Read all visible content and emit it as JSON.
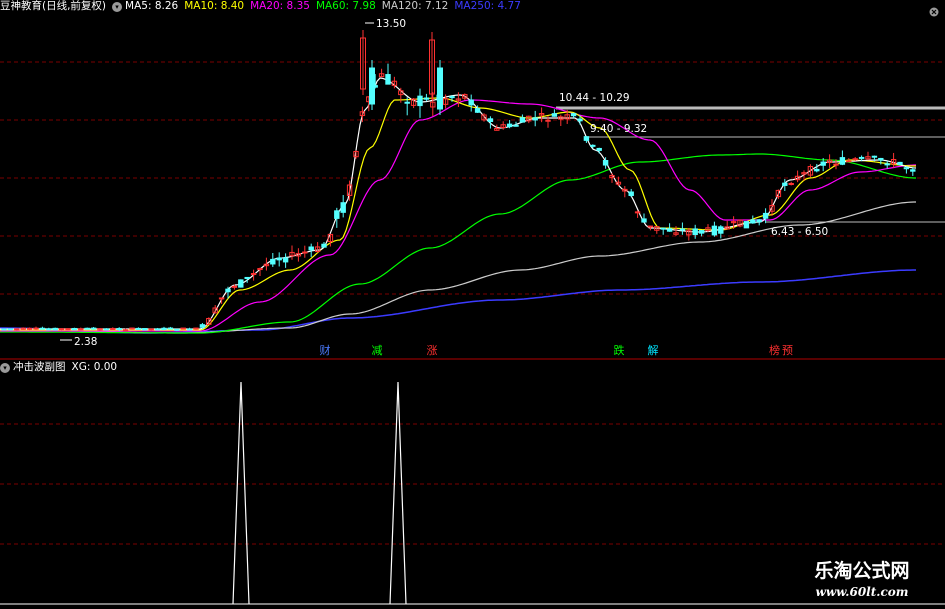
{
  "main_header": {
    "title": "豆神教育(日线,前复权)",
    "indicators": [
      {
        "label": "MA5: 8.26",
        "color": "#ffffff"
      },
      {
        "label": "MA10: 8.40",
        "color": "#ffff00"
      },
      {
        "label": "MA20: 8.35",
        "color": "#ff00ff"
      },
      {
        "label": "MA60: 7.98",
        "color": "#00ff00"
      },
      {
        "label": "MA120: 7.12",
        "color": "#cccccc"
      },
      {
        "label": "MA250: 4.77",
        "color": "#3b3bff"
      }
    ]
  },
  "sub_header": {
    "title": "冲击波副图",
    "value": "XG: 0.00"
  },
  "price_labels": {
    "high": "13.50",
    "low": "2.38",
    "range_top": "10.44 - 10.29",
    "range_mid": "9.40 - 9.32",
    "range_low": "6.43 - 6.50"
  },
  "events": [
    {
      "label": "财",
      "color": "#4b7bff"
    },
    {
      "label": "减",
      "color": "#00ff00"
    },
    {
      "label": "涨",
      "color": "#ff3030"
    },
    {
      "label": "跌",
      "color": "#00ff00"
    },
    {
      "label": "解",
      "color": "#00e5ff"
    },
    {
      "label": "榜",
      "color": "#ff3030"
    },
    {
      "label": "预",
      "color": "#ff3030"
    }
  ],
  "watermark": {
    "cn": "乐淘公式网",
    "url": "www.60lt.com"
  },
  "colors": {
    "up": "#ff3232",
    "down": "#54ffff",
    "ma5": "#ffffff",
    "ma10": "#ffff00",
    "ma20": "#ff00ff",
    "ma60": "#00ff00",
    "ma120": "#cccccc",
    "ma250": "#3b3bff",
    "grid": "#7a0000",
    "signal": "#ffffff"
  }
}
